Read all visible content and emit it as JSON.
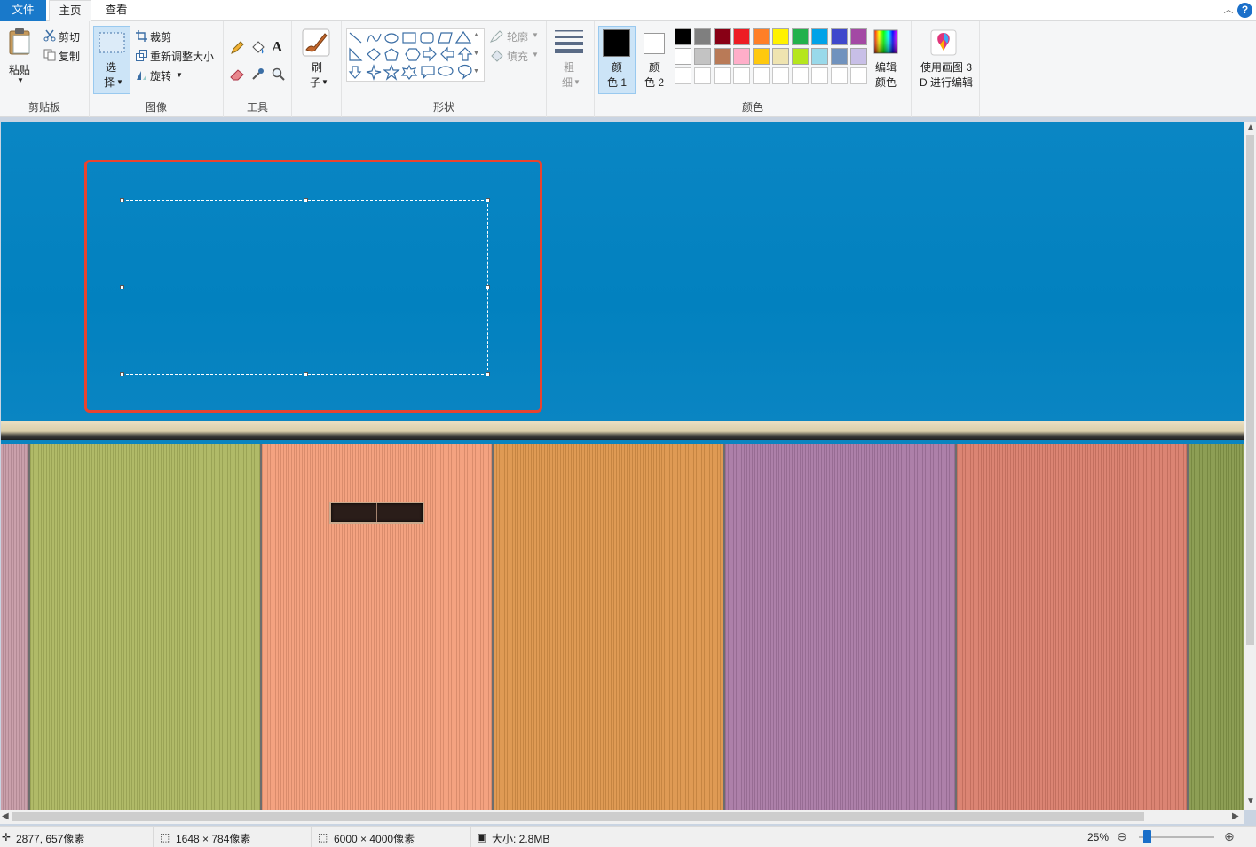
{
  "tabs": {
    "file": "文件",
    "home": "主页",
    "view": "查看"
  },
  "clipboard": {
    "paste": "粘贴",
    "cut": "剪切",
    "copy": "复制",
    "group": "剪贴板"
  },
  "image": {
    "select_1": "选",
    "select_2": "择",
    "crop": "裁剪",
    "resize": "重新调整大小",
    "rotate": "旋转",
    "group": "图像"
  },
  "tools": {
    "group": "工具"
  },
  "brushes": {
    "label_1": "刷",
    "label_2": "子"
  },
  "shapes": {
    "outline": "轮廓",
    "fill": "填充",
    "group": "形状"
  },
  "size": {
    "label_1": "粗",
    "label_2": "细"
  },
  "colors": {
    "color1_a": "颜",
    "color1_b": "色 1",
    "color2_a": "颜",
    "color2_b": "色 2",
    "edit_a": "编辑",
    "edit_b": "颜色",
    "group": "颜色",
    "color1_value": "#000000",
    "color2_value": "#ffffff",
    "palette_row1": [
      "#000000",
      "#7f7f7f",
      "#880015",
      "#ed1c24",
      "#ff7f27",
      "#fff200",
      "#22b14c",
      "#00a2e8",
      "#3f48cc",
      "#a349a4"
    ],
    "palette_row2": [
      "#ffffff",
      "#c3c3c3",
      "#b97a57",
      "#ffaec9",
      "#ffc90e",
      "#efe4b0",
      "#b5e61d",
      "#99d9ea",
      "#7092be",
      "#c8bfe7"
    ],
    "palette_row3": [
      "#ffffff",
      "#ffffff",
      "#ffffff",
      "#ffffff",
      "#ffffff",
      "#ffffff",
      "#ffffff",
      "#ffffff",
      "#ffffff",
      "#ffffff"
    ]
  },
  "paint3d": {
    "line_1": "使用画图 3",
    "line_2": "D 进行编辑"
  },
  "status": {
    "cursor": "2877, 657像素",
    "selection": "1648 × 784像素",
    "image_size": "6000 × 4000像素",
    "file_size": "大小: 2.8MB",
    "zoom": "25%"
  },
  "panels": [
    "#c79aa6",
    "#abb65f",
    "#f39c78",
    "#dd9449",
    "#a878a4",
    "#d97c6a",
    "#86984a"
  ],
  "icons": [
    "paste-icon",
    "cut-icon",
    "copy-icon",
    "select-icon",
    "crop-icon",
    "resize-icon",
    "rotate-icon",
    "pencil-icon",
    "fill-icon",
    "text-icon",
    "eraser-icon",
    "color-picker-icon",
    "magnifier-icon",
    "brush-icon",
    "outline-icon",
    "fill-shape-icon",
    "size-icon",
    "edit-colors-icon",
    "paint3d-icon",
    "help-icon"
  ]
}
